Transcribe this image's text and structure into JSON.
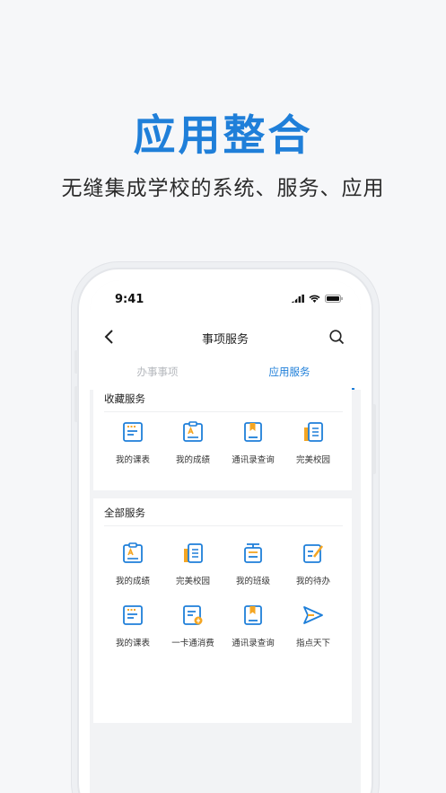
{
  "hero": {
    "title": "应用整合",
    "subtitle": "无缝集成学校的系统、服务、应用"
  },
  "colors": {
    "accent": "#1f7fd9",
    "orange": "#f5a623"
  },
  "status_bar": {
    "time": "9:41"
  },
  "navbar": {
    "title": "事项服务"
  },
  "tabs": [
    {
      "label": "办事事项",
      "active": false
    },
    {
      "label": "应用服务",
      "active": true
    }
  ],
  "favorites": {
    "title": "收藏服务",
    "items": [
      {
        "label": "我的课表",
        "icon": "timetable-icon"
      },
      {
        "label": "我的成绩",
        "icon": "grade-icon"
      },
      {
        "label": "通讯录查询",
        "icon": "contacts-icon"
      },
      {
        "label": "完美校园",
        "icon": "campus-icon"
      }
    ]
  },
  "all_services": {
    "title": "全部服务",
    "items": [
      {
        "label": "我的成绩",
        "icon": "grade-icon"
      },
      {
        "label": "完美校园",
        "icon": "campus-icon"
      },
      {
        "label": "我的班级",
        "icon": "class-icon"
      },
      {
        "label": "我的待办",
        "icon": "todo-icon"
      },
      {
        "label": "我的课表",
        "icon": "timetable-icon"
      },
      {
        "label": "一卡通消费",
        "icon": "card-payment-icon"
      },
      {
        "label": "通讯录查询",
        "icon": "contacts-icon"
      },
      {
        "label": "指点天下",
        "icon": "send-icon"
      }
    ]
  }
}
